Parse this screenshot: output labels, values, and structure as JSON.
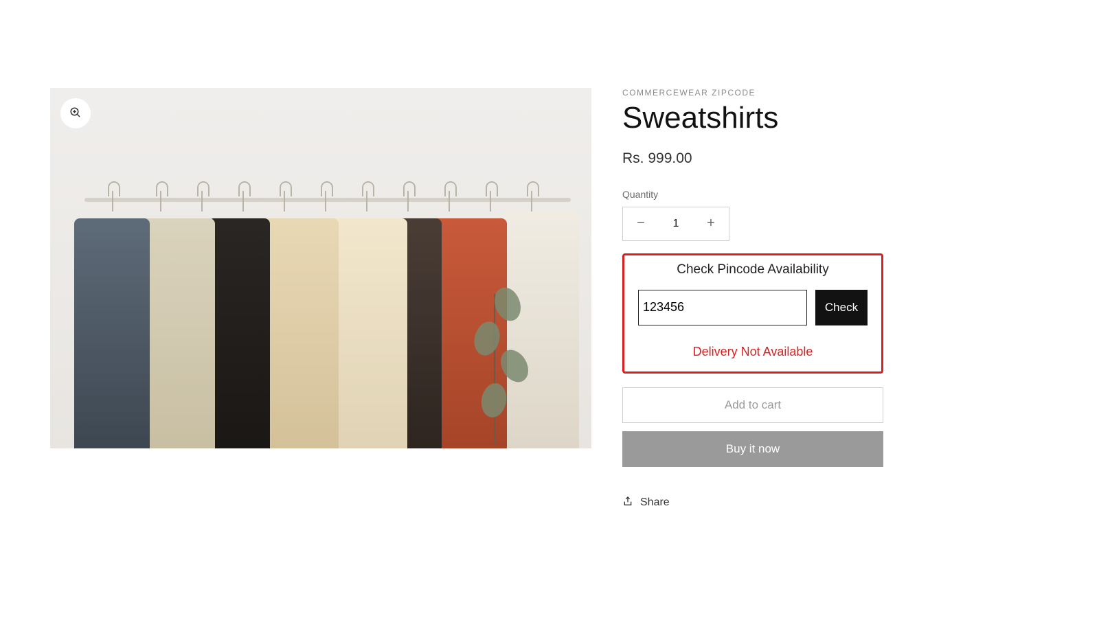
{
  "product": {
    "vendor": "COMMERCEWEAR ZIPCODE",
    "title": "Sweatshirts",
    "price": "Rs. 999.00"
  },
  "quantity": {
    "label": "Quantity",
    "value": "1"
  },
  "pincode": {
    "title": "Check Pincode Availability",
    "input_value": "123456",
    "check_label": "Check",
    "status_message": "Delivery Not Available"
  },
  "buttons": {
    "add_to_cart": "Add to cart",
    "buy_now": "Buy it now",
    "share": "Share"
  }
}
